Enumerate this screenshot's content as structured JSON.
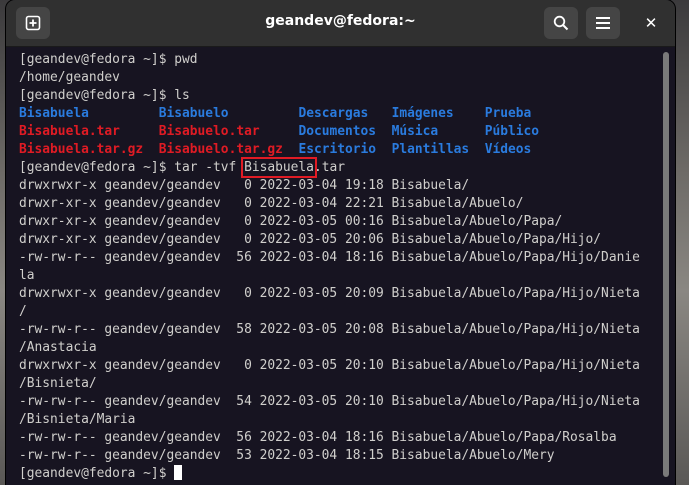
{
  "window": {
    "title": "geandev@fedora:~",
    "icons": {
      "new_tab": "new-tab-icon",
      "search": "search-icon",
      "menu": "hamburger-menu-icon"
    },
    "close_glyph": "✕"
  },
  "terminal": {
    "prompt": "[geandev@fedora ~]$ ",
    "cmd_pwd": "pwd",
    "out_pwd": "/home/geandev",
    "cmd_ls": "ls",
    "ls_rows": [
      [
        "Bisabuela",
        "Bisabuelo",
        "Descargas",
        "Imágenes",
        "Prueba"
      ],
      [
        "Bisabuela.tar",
        "Bisabuelo.tar",
        "Documentos",
        "Música",
        "Público"
      ],
      [
        "Bisabuela.tar.gz",
        "Bisabuelo.tar.gz",
        "Escritorio",
        "Plantillas",
        "Vídeos"
      ]
    ],
    "cmd_tar_prefix": "tar -tvf ",
    "cmd_tar_highlight": "Bisabuela",
    "cmd_tar_suffix": ".tar",
    "tar_lines": [
      "drwxrwxr-x geandev/geandev   0 2022-03-04 19:18 Bisabuela/",
      "drwxr-xr-x geandev/geandev   0 2022-03-04 22:21 Bisabuela/Abuelo/",
      "drwxr-xr-x geandev/geandev   0 2022-03-05 00:16 Bisabuela/Abuelo/Papa/",
      "drwxr-xr-x geandev/geandev   0 2022-03-05 20:06 Bisabuela/Abuelo/Papa/Hijo/",
      "-rw-rw-r-- geandev/geandev  56 2022-03-04 18:16 Bisabuela/Abuelo/Papa/Hijo/Danie",
      "la",
      "drwxrwxr-x geandev/geandev   0 2022-03-05 20:09 Bisabuela/Abuelo/Papa/Hijo/Nieta",
      "/",
      "-rw-rw-r-- geandev/geandev  58 2022-03-05 20:08 Bisabuela/Abuelo/Papa/Hijo/Nieta",
      "/Anastacia",
      "drwxrwxr-x geandev/geandev   0 2022-03-05 20:10 Bisabuela/Abuelo/Papa/Hijo/Nieta",
      "/Bisnieta/",
      "-rw-rw-r-- geandev/geandev  54 2022-03-05 20:10 Bisabuela/Abuelo/Papa/Hijo/Nieta",
      "/Bisnieta/Maria",
      "-rw-rw-r-- geandev/geandev  56 2022-03-04 18:16 Bisabuela/Abuelo/Papa/Rosalba",
      "-rw-rw-r-- geandev/geandev  53 2022-03-04 18:15 Bisabuela/Abuelo/Mery"
    ]
  },
  "colors": {
    "directory": "#2a7bde",
    "archive": "#e01b24",
    "highlight_box": "#e01b24",
    "terminal_bg": "#171421",
    "terminal_fg": "#d0cfcc"
  }
}
